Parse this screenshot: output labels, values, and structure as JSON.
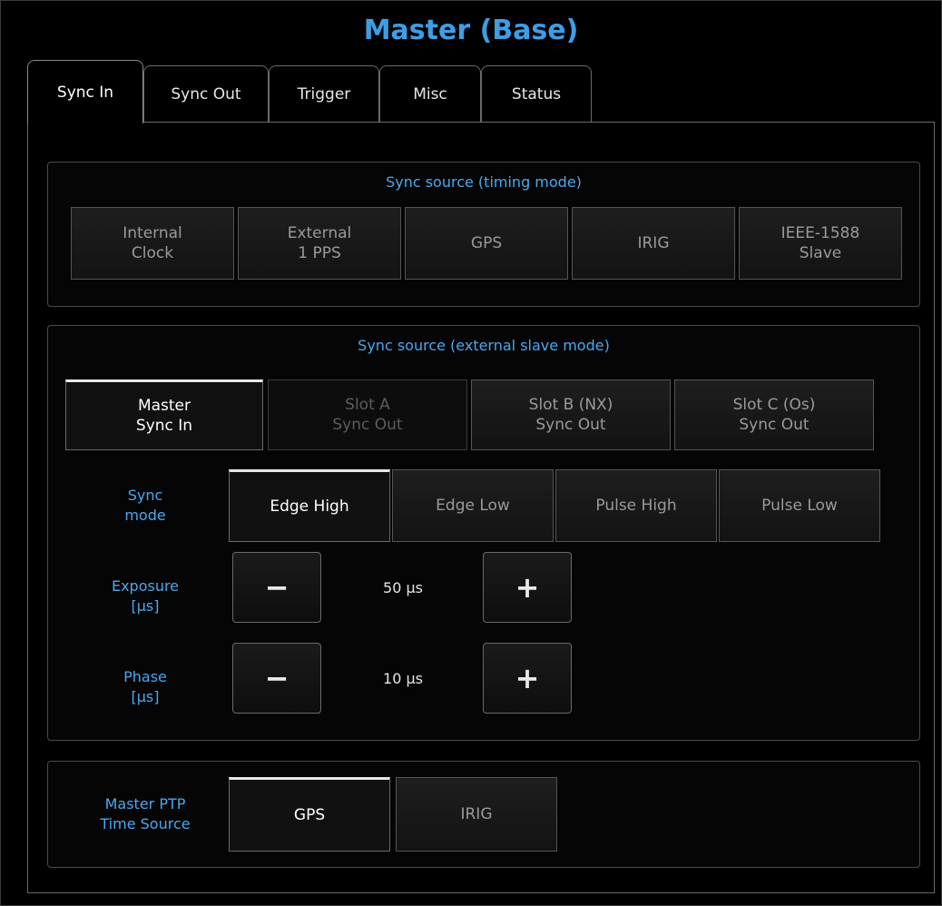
{
  "app": {
    "title": "Master (Base)"
  },
  "tabs": [
    {
      "label": "Sync In",
      "active": true
    },
    {
      "label": "Sync Out"
    },
    {
      "label": "Trigger"
    },
    {
      "label": "Misc"
    },
    {
      "label": "Status"
    }
  ],
  "timing_group": {
    "title": "Sync source (timing mode)",
    "buttons": [
      "Internal\nClock",
      "External\n1 PPS",
      "GPS",
      "IRIG",
      "IEEE-1588\nSlave"
    ]
  },
  "slave_group": {
    "title": "Sync source (external slave mode)",
    "sources": [
      {
        "label": "Master\nSync In",
        "state": "selected"
      },
      {
        "label": "Slot A\nSync Out",
        "state": "disabled"
      },
      {
        "label": "Slot B (NX)\nSync Out",
        "state": "normal"
      },
      {
        "label": "Slot C (Os)\nSync Out",
        "state": "normal"
      }
    ],
    "sync_mode": {
      "label": "Sync\nmode",
      "options": [
        {
          "label": "Edge High",
          "state": "selected"
        },
        {
          "label": "Edge Low",
          "state": "normal"
        },
        {
          "label": "Pulse High",
          "state": "normal"
        },
        {
          "label": "Pulse Low",
          "state": "normal"
        }
      ]
    },
    "exposure": {
      "label": "Exposure\n[µs]",
      "value": "50 µs",
      "minus": "−",
      "plus": "+"
    },
    "phase": {
      "label": "Phase\n[µs]",
      "value": "10 µs",
      "minus": "−",
      "plus": "+"
    }
  },
  "ptp_group": {
    "label": "Master PTP\nTime Source",
    "options": [
      {
        "label": "GPS",
        "state": "selected"
      },
      {
        "label": "IRIG",
        "state": "normal"
      }
    ]
  },
  "colors": {
    "accent": "#4aa8f0",
    "title": "#3d9ee6",
    "background": "#000000"
  }
}
